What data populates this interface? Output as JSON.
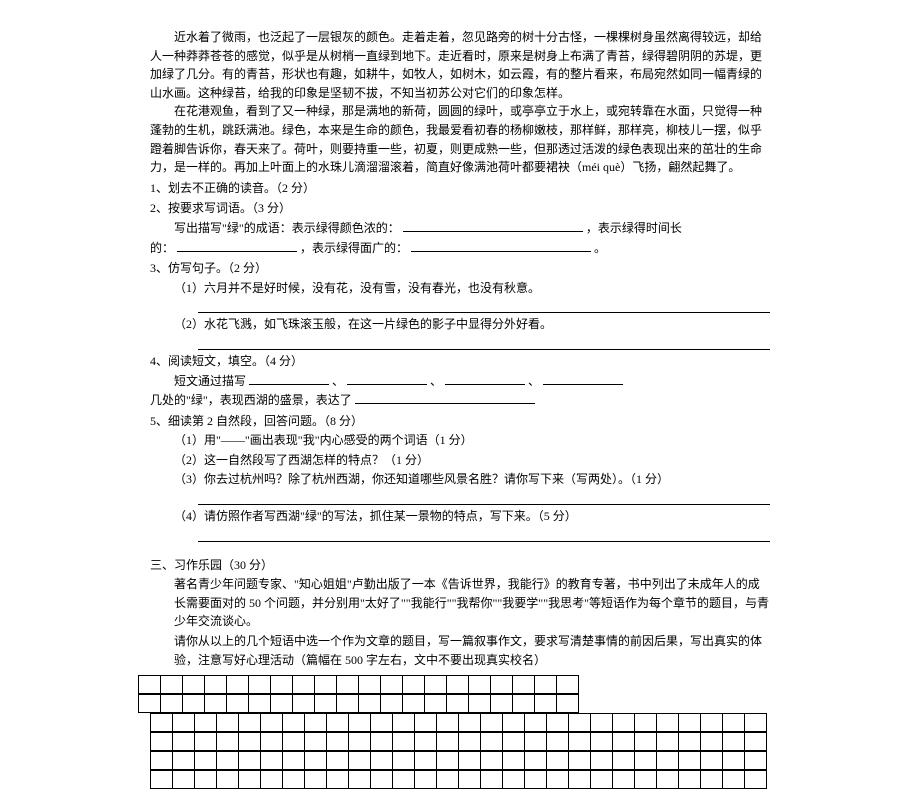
{
  "passage": {
    "p1": "近水着了微雨，也泛起了一层银灰的颜色。走着走着，忽见路旁的树十分古怪，一棵棵树身虽然离得较远，却给人一种莽莽苍苍的感觉，似乎是从树梢一直绿到地下。走近看时，原来是树身上布满了青苔，绿得碧阴阴的苏堤，更加绿了几分。有的青苔，形状也有趣，如耕牛，如牧人，如树木，如云霞，有的整片看来，布局宛然如同一幅青绿的山水画。这种绿苔，给我的印象是坚韧不拔，不知当初苏公对它们的印象怎样。",
    "p2": "在花港观鱼，看到了又一种绿，那是满地的新荷，圆圆的绿叶，或亭亭立于水上，或宛转靠在水面，只觉得一种蓬勃的生机，跳跃满池。绿色，本来是生命的颜色，我最爱看初春的杨柳嫩枝，那样鲜，那样亮，柳枝儿一摆，似乎蹬着脚告诉你，春天来了。荷叶，则要持重一些，初夏，则更成熟一些，但那透过活泼的绿色表现出来的茁壮的生命力，是一样的。再加上叶面上的水珠儿滴溜溜滚着，简直好像满池荷叶都要裙袂（méi  què）飞扬，翩然起舞了。"
  },
  "q1": {
    "title": "1、划去不正确的读音。（2 分）"
  },
  "q2": {
    "title": "2、按要求写词语。（3 分）",
    "line1_pre": "写出描写\"绿\"的成语：表示绿得颜色浓的：",
    "line1_post": "，表示绿得时间长",
    "line2_pre": "的：",
    "line2_mid": "，表示绿得面广的：",
    "line2_post": "。"
  },
  "q3": {
    "title": "3、仿写句子。（2 分）",
    "s1": "（1）六月并不是好时候，没有花，没有雪，没有春光，也没有秋意。",
    "s2": "（2）水花飞溅，如飞珠滚玉般，在这一片绿色的影子中显得分外好看。"
  },
  "q4": {
    "title": "4、阅读短文，填空。（4 分）",
    "s1_pre": "短文通过描写",
    "sep": "、",
    "s2_pre": "几处的\"绿\"，表现西湖的盛景，表达了"
  },
  "q5": {
    "title": "5、细读第 2 自然段，回答问题。（8 分）",
    "s1": "（1）用\"——\"画出表现\"我\"内心感受的两个词语（1 分）",
    "s2": "（2）这一自然段写了西湖怎样的特点？（1 分）",
    "s3": "（3）你去过杭州吗？除了杭州西湖，你还知道哪些风景名胜？请你写下来（写两处）。（1 分）",
    "s4": "（4）请仿照作者写西湖\"绿\"的写法，抓住某一景物的特点，写下来。（5 分）"
  },
  "essay": {
    "heading": "三、习作乐园（30 分）",
    "p1": "著名青少年问题专家、\"知心姐姐\"卢勤出版了一本《告诉世界，我能行》的教育专著，书中列出了未成年人的成长需要面对的 50 个问题，并分别用\"太好了\"\"我能行\"\"我帮你\"\"我要学\"\"我思考\"等短语作为每个章节的题目，与青少年交流谈心。",
    "p2": "请你从以上的几个短语中选一个作为文章的题目，写一篇叙事作文，要求写清楚事情的前因后果，写出真实的体验，注意写好心理活动（篇幅在 500 字左右，文中不要出现真实校名）"
  }
}
